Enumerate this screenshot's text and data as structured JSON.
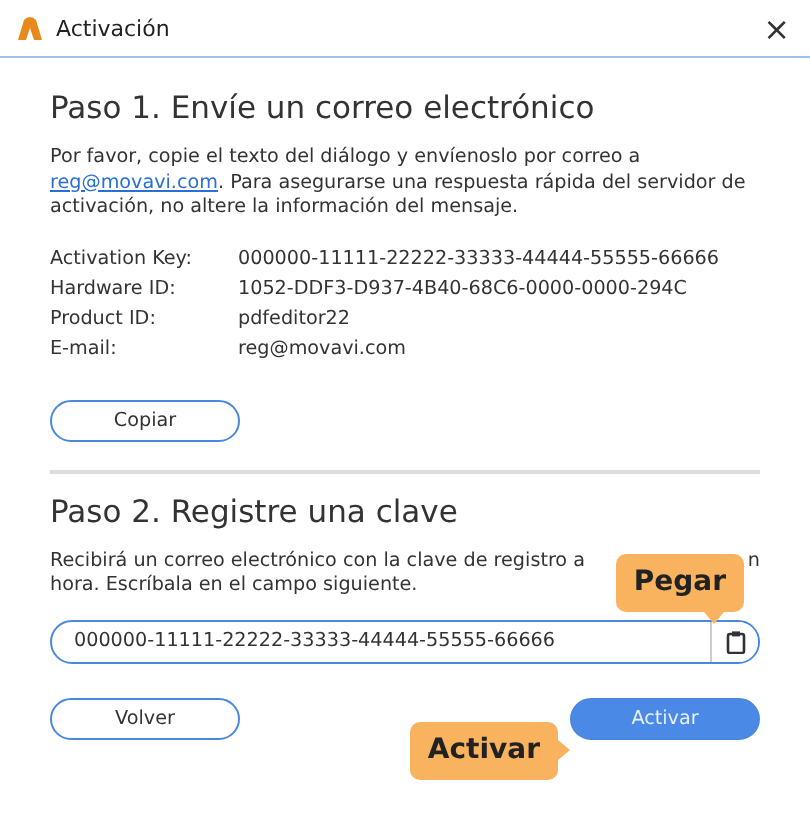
{
  "window": {
    "title": "Activación",
    "close": "×"
  },
  "step1": {
    "heading": "Paso 1. Envíe un correo electrónico",
    "text_before": "Por favor, copie el texto del diálogo y envíenoslo por correo a",
    "link": "reg@movavi.com",
    "text_after": ". Para asegurarse una respuesta rápida del servidor de activación, no altere la información del mensaje.",
    "fields": [
      {
        "label": "Activation Key:",
        "value": "000000-11111-22222-33333-44444-55555-66666"
      },
      {
        "label": "Hardware ID:",
        "value": "1052-DDF3-D937-4B40-68C6-0000-0000-294C"
      },
      {
        "label": "Product ID:",
        "value": "pdfeditor22"
      },
      {
        "label": "E-mail:",
        "value": "reg@movavi.com"
      }
    ],
    "copy_button": "Copiar"
  },
  "step2": {
    "heading": "Paso 2. Registre una clave",
    "line1": "Recibirá un correo electrónico con la clave de registro a",
    "line1_end": "n",
    "line2": "hora. Escríbala en el campo siguiente.",
    "key_value": "000000-11111-22222-33333-44444-55555-66666",
    "back_button": "Volver",
    "activate_button": "Activar"
  },
  "callouts": [
    {
      "kind": "above",
      "text": "Pegar"
    },
    {
      "kind": "left",
      "text": "Activar"
    }
  ]
}
